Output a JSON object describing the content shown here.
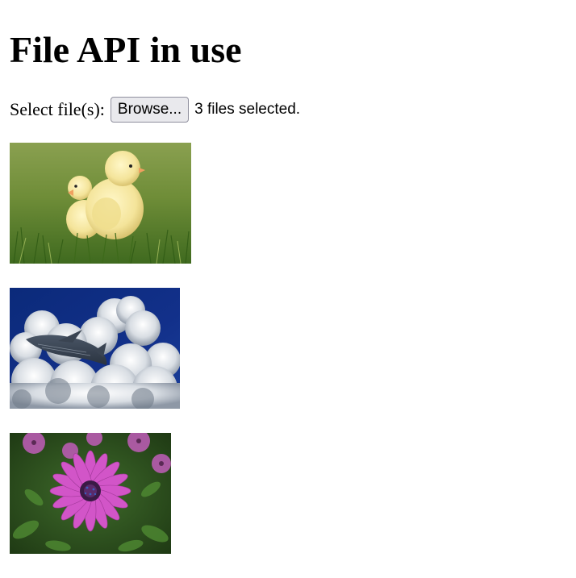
{
  "page": {
    "heading": "File API in use",
    "file_picker": {
      "label": "Select file(s):",
      "button_label": "Browse...",
      "status": "3 files selected."
    },
    "previews": [
      {
        "subject": "chicks-in-grass-image"
      },
      {
        "subject": "whale-in-clouds-image"
      },
      {
        "subject": "purple-daisy-flower-image"
      }
    ]
  }
}
